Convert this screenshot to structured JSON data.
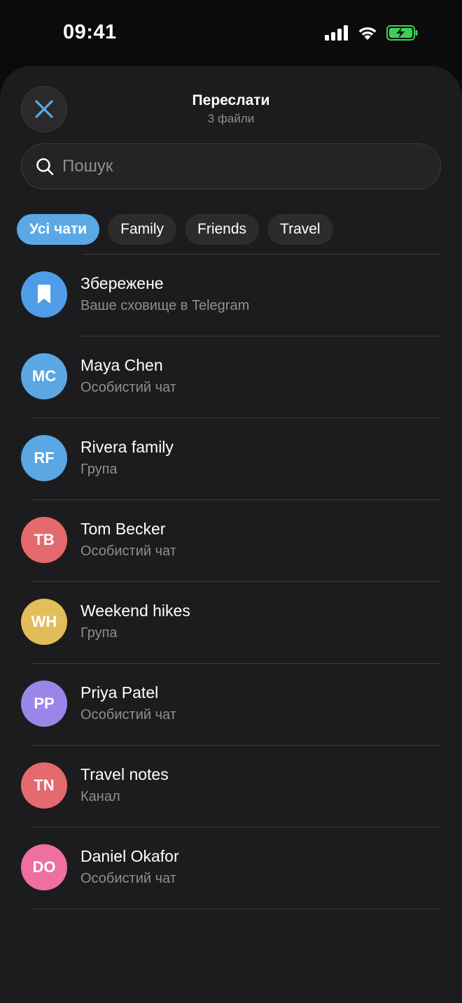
{
  "status_bar": {
    "time": "09:41"
  },
  "header": {
    "title": "Переслати",
    "subtitle": "3 файли",
    "close_icon": "close-icon"
  },
  "search": {
    "placeholder": "Пошук",
    "value": ""
  },
  "tabs": [
    {
      "label": "Усі чати",
      "active": true
    },
    {
      "label": "Family",
      "active": false
    },
    {
      "label": "Friends",
      "active": false
    },
    {
      "label": "Travel",
      "active": false
    }
  ],
  "chats": [
    {
      "name": "Збережене",
      "subtitle": "Ваше сховище в Telegram",
      "initials": "",
      "icon": "bookmark-icon",
      "color": "#4f9de8"
    },
    {
      "name": "Maya Chen",
      "subtitle": "Особистий чат",
      "initials": "MC",
      "color": "#5aa7e3"
    },
    {
      "name": "Rivera family",
      "subtitle": "Група",
      "initials": "RF",
      "color": "#5aa7e3"
    },
    {
      "name": "Tom Becker",
      "subtitle": "Особистий чат",
      "initials": "TB",
      "color": "#e46a6e"
    },
    {
      "name": "Weekend hikes",
      "subtitle": "Група",
      "initials": "WH",
      "color": "#e2be5a"
    },
    {
      "name": "Priya Patel",
      "subtitle": "Особистий чат",
      "initials": "PP",
      "color": "#9a86e8"
    },
    {
      "name": "Travel notes",
      "subtitle": "Канал",
      "initials": "TN",
      "color": "#e46a6e"
    },
    {
      "name": "Daniel Okafor",
      "subtitle": "Особистий чат",
      "initials": "DO",
      "color": "#ee6fa0"
    }
  ],
  "colors": {
    "accent": "#5aa9e6",
    "battery": "#3ecf5a"
  }
}
